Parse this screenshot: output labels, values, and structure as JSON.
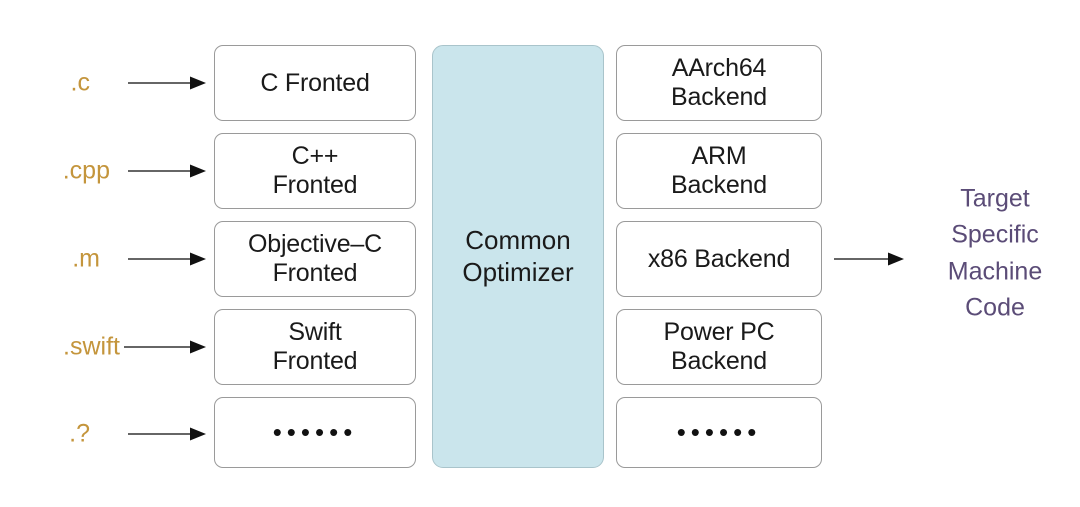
{
  "diagram": {
    "title": "Compiler frontend / optimizer / backend architecture",
    "background_color": "#ffffff",
    "colors": {
      "extension_label": "#c4953c",
      "box_border": "#9a9a9a",
      "box_fill": "#ffffff",
      "optimizer_fill": "#cae5ec",
      "optimizer_border": "#a9c4cb",
      "box_text": "#1a1a1a",
      "output_text": "#5b4c77",
      "arrow": "#333333"
    }
  },
  "inputs": [
    {
      "label": ".c",
      "name": "ext-label-c"
    },
    {
      "label": ".cpp",
      "name": "ext-label-cpp"
    },
    {
      "label": ".m",
      "name": "ext-label-m"
    },
    {
      "label": ".swift",
      "name": "ext-label-swift"
    },
    {
      "label": ".?",
      "name": "ext-label-other"
    }
  ],
  "frontends": [
    {
      "label": "C Fronted",
      "name": "frontend-c"
    },
    {
      "label": "C++\nFronted",
      "name": "frontend-cpp"
    },
    {
      "label": "Objective–C\nFronted",
      "name": "frontend-objective-c"
    },
    {
      "label": "Swift\nFronted",
      "name": "frontend-swift"
    },
    {
      "label": "••••••",
      "name": "frontend-more"
    }
  ],
  "optimizer": {
    "label": "Common\nOptimizer",
    "name": "common-optimizer"
  },
  "backends": [
    {
      "label": "AArch64\nBackend",
      "name": "backend-aarch64"
    },
    {
      "label": "ARM\nBackend",
      "name": "backend-arm"
    },
    {
      "label": "x86 Backend",
      "name": "backend-x86"
    },
    {
      "label": "Power PC\nBackend",
      "name": "backend-powerpc"
    },
    {
      "label": "••••••",
      "name": "backend-more"
    }
  ],
  "output": {
    "label": "Target\nSpecific\nMachine\nCode",
    "name": "target-specific-machine-code"
  },
  "arrows": [
    {
      "name": "arrow-c-to-frontend",
      "from": ".c",
      "to": "C Fronted"
    },
    {
      "name": "arrow-cpp-to-frontend",
      "from": ".cpp",
      "to": "C++ Fronted"
    },
    {
      "name": "arrow-m-to-frontend",
      "from": ".m",
      "to": "Objective–C Fronted"
    },
    {
      "name": "arrow-swift-to-frontend",
      "from": ".swift",
      "to": "Swift Fronted"
    },
    {
      "name": "arrow-other-to-frontend",
      "from": ".?",
      "to": "••••••"
    },
    {
      "name": "arrow-x86-to-output",
      "from": "x86 Backend",
      "to": "Target Specific Machine Code"
    }
  ]
}
